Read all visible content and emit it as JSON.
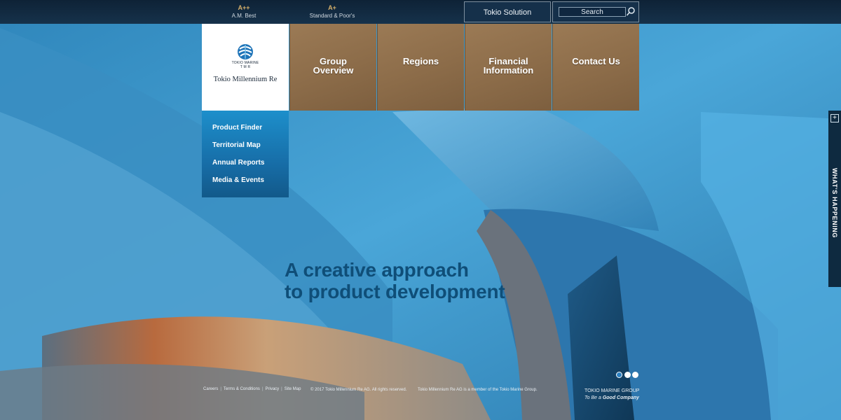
{
  "ratings": [
    {
      "grade": "A++",
      "agency": "A.M. Best"
    },
    {
      "grade": "A+",
      "agency": "Standard & Poor's"
    }
  ],
  "header": {
    "tokio_solution_label": "Tokio Solution",
    "search_placeholder": "Search"
  },
  "logo": {
    "small_text_1": "TOKIO MARINE",
    "small_text_2": "T M R",
    "name": "Tokio Millennium Re"
  },
  "nav": {
    "items": [
      {
        "line1": "Group",
        "line2": "Overview"
      },
      {
        "line1": "Regions",
        "line2": ""
      },
      {
        "line1": "Financial",
        "line2": "Information"
      },
      {
        "line1": "Contact Us",
        "line2": ""
      }
    ]
  },
  "submenu": {
    "items": [
      "Product Finder",
      "Territorial Map",
      "Annual Reports",
      "Media & Events"
    ]
  },
  "hero": {
    "line1": "A creative approach",
    "line2": "to product development"
  },
  "side_tab": {
    "label": "WHAT'S HAPPENING",
    "plus": "+"
  },
  "carousel": {
    "count": 3,
    "active_index": 0
  },
  "footer": {
    "links": [
      "Careers",
      "Terms & Conditions",
      "Privacy",
      "Site Map"
    ],
    "copyright": "© 2017 Tokio Millennium Re AG. All rights reserved.",
    "member": "Tokio Millennium Re AG is a member of the Tokio Marine Group.",
    "group_name": "TOKIO MARINE GROUP",
    "group_tagline_prefix": "To Be a",
    "group_tagline_emphasis": "Good Company"
  },
  "colors": {
    "accent_bronze": "#8c6c49",
    "submenu_blue": "#176ea8",
    "headline_blue": "#0f4e78",
    "topbar_navy": "#16324b"
  }
}
